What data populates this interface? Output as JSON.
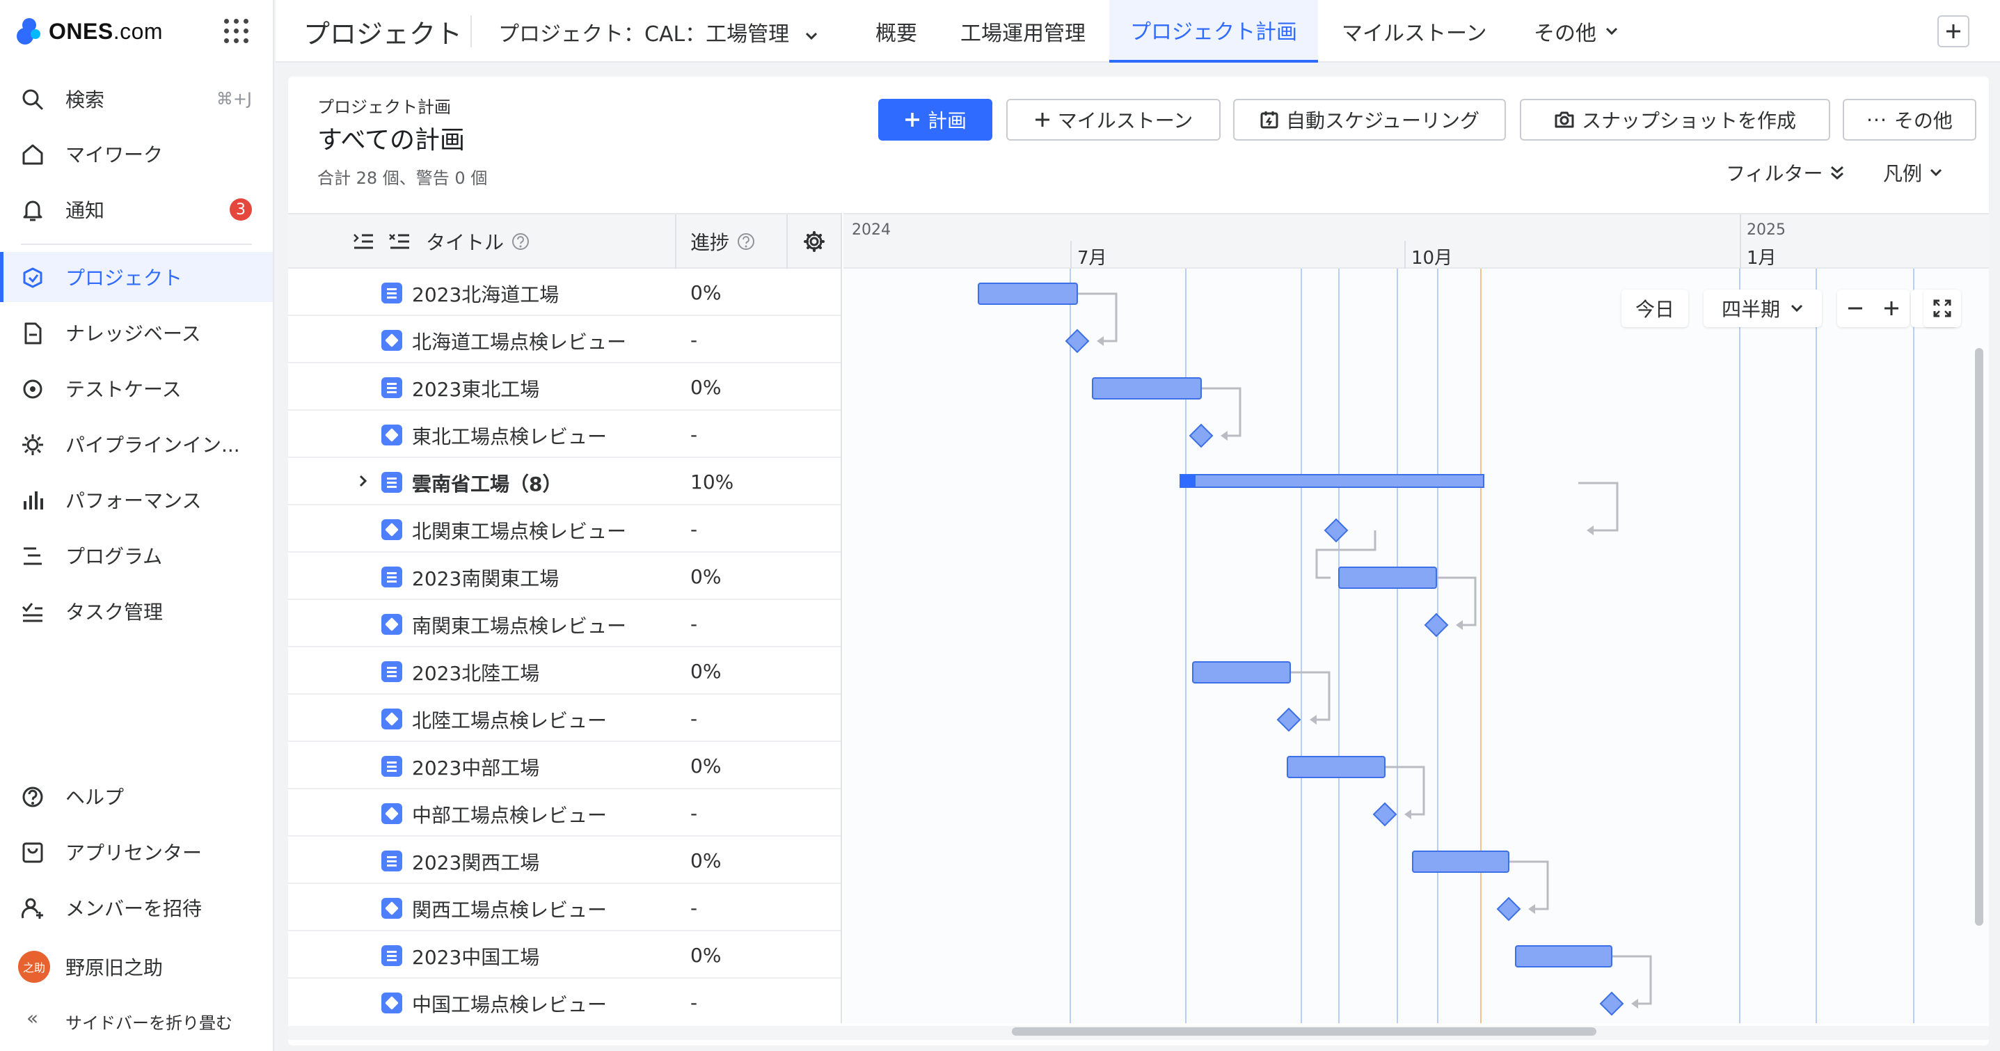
{
  "app": {
    "brand": "ONES",
    "brand_suffix": ".com"
  },
  "sidebar": {
    "items": [
      {
        "label": "検索",
        "icon": "search-icon",
        "shortcut": "⌘+J"
      },
      {
        "label": "マイワーク",
        "icon": "home-icon"
      },
      {
        "label": "通知",
        "icon": "bell-icon",
        "badge": "3"
      },
      {
        "label": "プロジェクト",
        "icon": "project-icon",
        "active": true
      },
      {
        "label": "ナレッジベース",
        "icon": "document-icon"
      },
      {
        "label": "テストケース",
        "icon": "test-case-icon"
      },
      {
        "label": "パイプラインイン...",
        "icon": "pipeline-icon"
      },
      {
        "label": "パフォーマンス",
        "icon": "bar-chart-icon"
      },
      {
        "label": "プログラム",
        "icon": "program-icon"
      },
      {
        "label": "タスク管理",
        "icon": "checklist-icon"
      }
    ],
    "bottom": [
      {
        "label": "ヘルプ",
        "icon": "help-icon"
      },
      {
        "label": "アプリセンター",
        "icon": "app-center-icon"
      },
      {
        "label": "メンバーを招待",
        "icon": "invite-member-icon"
      }
    ],
    "user": {
      "name": "野原旧之助",
      "avatar_text": "之助",
      "avatar_color": "#e8622f"
    },
    "collapse_label": "サイドバーを折り畳む"
  },
  "header": {
    "title": "プロジェクト",
    "project_selector": "プロジェクト：CAL：工場管理",
    "tabs": [
      {
        "label": "概要"
      },
      {
        "label": "工場運用管理"
      },
      {
        "label": "プロジェクト計画",
        "active": true
      },
      {
        "label": "マイルストーン"
      },
      {
        "label": "その他"
      }
    ]
  },
  "page": {
    "breadcrumb": "プロジェクト計画",
    "title": "すべての計画",
    "summary": "合計 28 個、警告 0 個",
    "buttons": {
      "plan": "計画",
      "milestone": "マイルストーン",
      "auto_schedule": "自動スケジューリング",
      "snapshot": "スナップショットを作成",
      "more": "その他"
    },
    "filter_label": "フィルター",
    "legend_label": "凡例"
  },
  "table": {
    "headers": {
      "title": "タイトル",
      "progress": "進捗"
    },
    "rows": [
      {
        "type": "plan",
        "title": "2023北海道工場",
        "progress": "0%"
      },
      {
        "type": "milestone",
        "title": "北海道工場点検レビュー",
        "progress": "-"
      },
      {
        "type": "plan",
        "title": "2023東北工場",
        "progress": "0%"
      },
      {
        "type": "milestone",
        "title": "東北工場点検レビュー",
        "progress": "-"
      },
      {
        "type": "plan",
        "title": "雲南省工場（8）",
        "progress": "10%",
        "expandable": true
      },
      {
        "type": "milestone",
        "title": "北関東工場点検レビュー",
        "progress": "-"
      },
      {
        "type": "plan",
        "title": "2023南関東工場",
        "progress": "0%"
      },
      {
        "type": "milestone",
        "title": "南関東工場点検レビュー",
        "progress": "-"
      },
      {
        "type": "plan",
        "title": "2023北陸工場",
        "progress": "0%"
      },
      {
        "type": "milestone",
        "title": "北陸工場点検レビュー",
        "progress": "-"
      },
      {
        "type": "plan",
        "title": "2023中部工場",
        "progress": "0%"
      },
      {
        "type": "milestone",
        "title": "中部工場点検レビュー",
        "progress": "-"
      },
      {
        "type": "plan",
        "title": "2023関西工場",
        "progress": "0%"
      },
      {
        "type": "milestone",
        "title": "関西工場点検レビュー",
        "progress": "-"
      },
      {
        "type": "plan",
        "title": "2023中国工場",
        "progress": "0%"
      },
      {
        "type": "milestone",
        "title": "中国工場点検レビュー",
        "progress": "-"
      }
    ]
  },
  "gantt": {
    "years": [
      "2024",
      "2025"
    ],
    "months": [
      "7月",
      "10月",
      "1月"
    ],
    "controls": {
      "today": "今日",
      "scale": "四半期"
    },
    "colors": {
      "bar": "#85a7f5",
      "bar_border": "#3d6fe6",
      "link": "#b9bcc2",
      "today_line": "#f3c18f",
      "grid": "#b8cdf7"
    }
  }
}
